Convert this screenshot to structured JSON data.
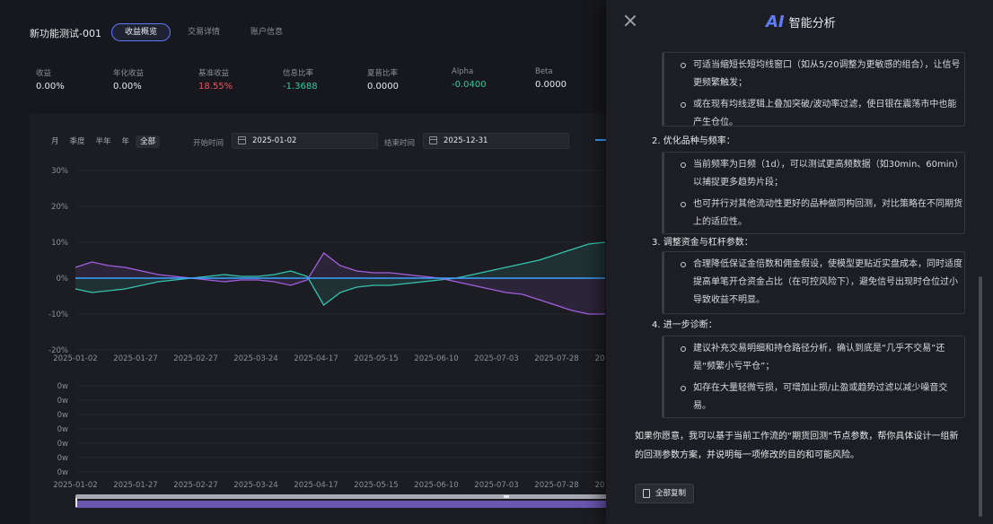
{
  "header": {
    "strategy_name": "新功能测试-001",
    "tabs": [
      {
        "label": "收益概览",
        "active": true
      },
      {
        "label": "交易详情",
        "active": false
      },
      {
        "label": "账户信息",
        "active": false
      }
    ]
  },
  "metrics": [
    {
      "label": "收益",
      "value": "0.00%",
      "tone": "normal"
    },
    {
      "label": "年化收益",
      "value": "0.00%",
      "tone": "normal"
    },
    {
      "label": "基准收益",
      "value": "18.55%",
      "tone": "red"
    },
    {
      "label": "信息比率",
      "value": "-1.3688",
      "tone": "green"
    },
    {
      "label": "夏普比率",
      "value": "0.0000",
      "tone": "normal"
    },
    {
      "label": "Alpha",
      "value": "-0.0400",
      "tone": "green"
    },
    {
      "label": "Beta",
      "value": "0.0000",
      "tone": "normal"
    }
  ],
  "filters": {
    "periods": [
      {
        "label": "月",
        "active": false
      },
      {
        "label": "季度",
        "active": false
      },
      {
        "label": "半年",
        "active": false
      },
      {
        "label": "年",
        "active": false
      },
      {
        "label": "全部",
        "active": true
      }
    ],
    "start_label": "开始时间",
    "start_value": "2025-01-02",
    "end_label": "结束时间",
    "end_value": "2025-12-31"
  },
  "chart_data": [
    {
      "type": "line",
      "x_labels": [
        "2025-01-02",
        "2025-01-27",
        "2025-02-27",
        "2025-03-24",
        "2025-04-17",
        "2025-05-15",
        "2025-06-10",
        "2025-07-03",
        "2025-07-28",
        "20"
      ],
      "y_tick_labels": [
        "30%",
        "20%",
        "10%",
        "0%",
        "-10%",
        "-20%"
      ],
      "ylim": [
        -20,
        30
      ],
      "grid": true,
      "series_colors": [
        "#36c3b0",
        "#a35ee0",
        "#3fa0ff"
      ],
      "series": [
        {
          "values": [
            -3,
            -4,
            -3.5,
            -3,
            -2,
            -1,
            -0.5,
            0,
            0.5,
            1,
            0.5,
            0.5,
            1,
            2,
            0.5,
            -7.5,
            -4,
            -2.5,
            -2,
            -2,
            -1.5,
            -1,
            -0.5,
            0,
            1,
            2,
            3,
            4,
            5,
            6.5,
            8,
            9.5,
            10
          ]
        },
        {
          "values": [
            3,
            4.5,
            3.5,
            3,
            2,
            1,
            0.5,
            0,
            -0.5,
            -1,
            -0.5,
            -0.5,
            -1,
            -2,
            -0.5,
            7,
            3.5,
            2,
            1.5,
            1.5,
            1,
            0.5,
            0,
            -1,
            -2,
            -3,
            -4,
            -4.5,
            -6,
            -7.5,
            -9,
            -10,
            -10
          ]
        },
        {
          "values": [
            0,
            0,
            0,
            0,
            0,
            0,
            0,
            0,
            0,
            0,
            0,
            0,
            0,
            0,
            0,
            0,
            0,
            0,
            0,
            0,
            0,
            0,
            0,
            0,
            0,
            0,
            0,
            0,
            0,
            0,
            0,
            0,
            0
          ]
        }
      ]
    },
    {
      "type": "bar",
      "x_labels": [
        "2025-01-02",
        "2025-01-27",
        "2025-02-27",
        "2025-03-24",
        "2025-04-17",
        "2025-05-15",
        "2025-06-10",
        "2025-07-03",
        "2025-07-28",
        "20"
      ],
      "y_tick_labels": [
        "0w",
        "0w",
        "0w",
        "0w",
        "0w",
        "0w",
        "0w"
      ],
      "values": []
    }
  ],
  "ai_panel": {
    "logo": "AI",
    "title": "智能分析",
    "box1_bullets": [
      "可适当缩短长短均线窗口（如从5/20调整为更敏感的组合），让信号更频繁触发；",
      "或在现有均线逻辑上叠加突破/波动率过滤，使日银在震荡市中也能产生仓位。"
    ],
    "section2": "2. 优化品种与频率：",
    "box2_bullets": [
      "当前频率为日频（1d），可以测试更高频数据（如30min、60min）以捕捉更多趋势片段；",
      "也可并行对其他流动性更好的品种做同构回测，对比策略在不同期货上的适应性。"
    ],
    "section3": "3. 调整资金与杠杆参数：",
    "box3_bullets": [
      "合理降低保证金倍数和佣金假设，使模型更贴近实盘成本，同时适度提高单笔开仓资金占比（在可控风险下），避免信号出现时仓位过小导致收益不明显。"
    ],
    "section4": "4. 进一步诊断：",
    "box4_bullets": [
      "建议补充交易明细和持仓路径分析，确认到底是“几乎不交易”还是“频繁小亏平仓”；",
      "如存在大量轻微亏损，可增加止损/止盈或趋势过滤以减少噪音交易。"
    ],
    "closing": "如果你愿意，我可以基于当前工作流的“期货回测”节点参数，帮你具体设计一组新的回测参数方案，并说明每一项修改的目的和可能风险。",
    "copy_label": "全部复制"
  }
}
